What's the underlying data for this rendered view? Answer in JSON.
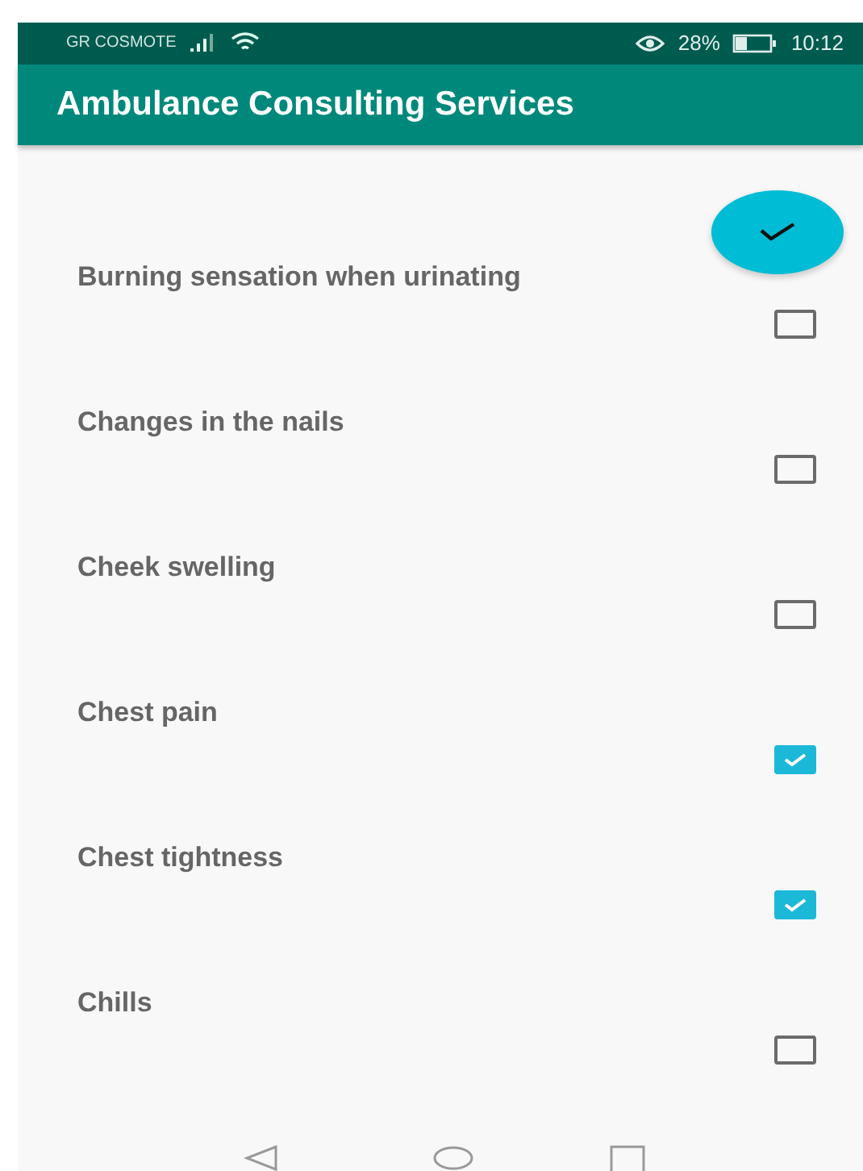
{
  "status_bar": {
    "carrier": "GR COSMOTE",
    "battery": "28%",
    "time": "10:12"
  },
  "app_bar": {
    "title": "Ambulance Consulting Services"
  },
  "symptoms": [
    {
      "label": "Burning sensation when urinating",
      "checked": false
    },
    {
      "label": "Changes in the nails",
      "checked": false
    },
    {
      "label": "Cheek swelling",
      "checked": false
    },
    {
      "label": "Chest pain",
      "checked": true
    },
    {
      "label": "Chest tightness",
      "checked": true
    },
    {
      "label": "Chills",
      "checked": false
    }
  ]
}
